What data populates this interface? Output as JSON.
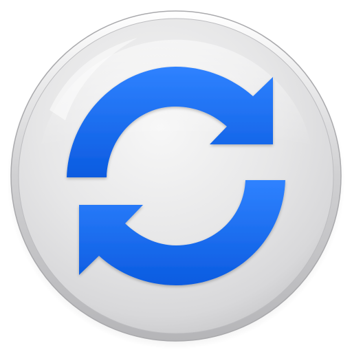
{
  "icon": {
    "name": "refresh-sync-icon",
    "shape": "round glossy button",
    "arrow_color": "#1a6ff0",
    "arrow_color_dark": "#0b55d8",
    "button_face": "#e9e9ea",
    "button_rim": "#c9c9cb"
  }
}
